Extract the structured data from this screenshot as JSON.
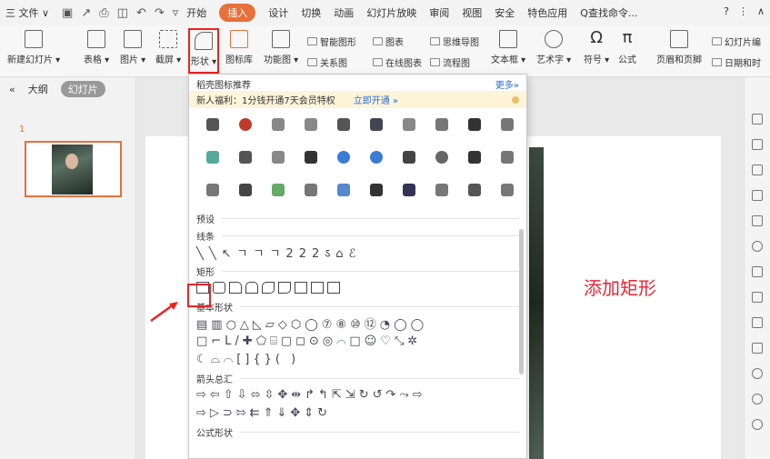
{
  "menubar": {
    "file_label": "三 文件 ∨",
    "tabs": [
      "开始",
      "插入",
      "设计",
      "切换",
      "动画",
      "幻灯片放映",
      "审阅",
      "视图",
      "安全",
      "特色应用"
    ],
    "active_tab": "插入",
    "search_label": "Q查找命令...",
    "help": "?",
    "more": "⋮",
    "collapse": "∧"
  },
  "ribbon": {
    "new_slide": "新建幻灯片 ▾",
    "table": "表格 ▾",
    "picture": "图片 ▾",
    "screenshot": "截屏 ▾",
    "shape": "形状 ▾",
    "icon_lib": "图标库",
    "function_chart": "功能图 ▾",
    "smart_art": "智能图形",
    "chart": "图表",
    "mind_map": "思维导图",
    "relation": "关系图",
    "online_chart": "在线图表",
    "flowchart": "流程图",
    "textbox": "文本框 ▾",
    "art_text": "艺术字 ▾",
    "symbol": "符号 ▾",
    "formula": "公式",
    "header_footer": "页眉和页脚",
    "slide_num": "幻灯片编",
    "date": "日期和时"
  },
  "leftpanel": {
    "collapse": "«",
    "outline_tab": "大纲",
    "slides_tab": "幻灯片",
    "slide_number": "1"
  },
  "dropdown": {
    "header": "稻壳图标推荐",
    "more": "更多»",
    "promo_text": "新人福利：1分钱开通7天会员特权",
    "promo_link": "立即开通 »",
    "presets_label": "预设",
    "sec_lines": "线条",
    "sec_rect": "矩形",
    "sec_basic": "基本形状",
    "sec_arrows": "箭头总汇",
    "sec_formula": "公式形状",
    "icon_colors": [
      "#555",
      "#c0392b",
      "#888",
      "#888",
      "#555",
      "#445",
      "#888",
      "#777",
      "#333",
      "#777",
      "#5a9",
      "#555",
      "#888",
      "#333",
      "#3a7bd5",
      "#3a7bd5",
      "#444",
      "#666",
      "#333",
      "#777",
      "#777",
      "#444",
      "#6a6",
      "#777",
      "#58c",
      "#333",
      "#335",
      "#777",
      "#555",
      "#777"
    ]
  },
  "annotation": "添加矩形"
}
